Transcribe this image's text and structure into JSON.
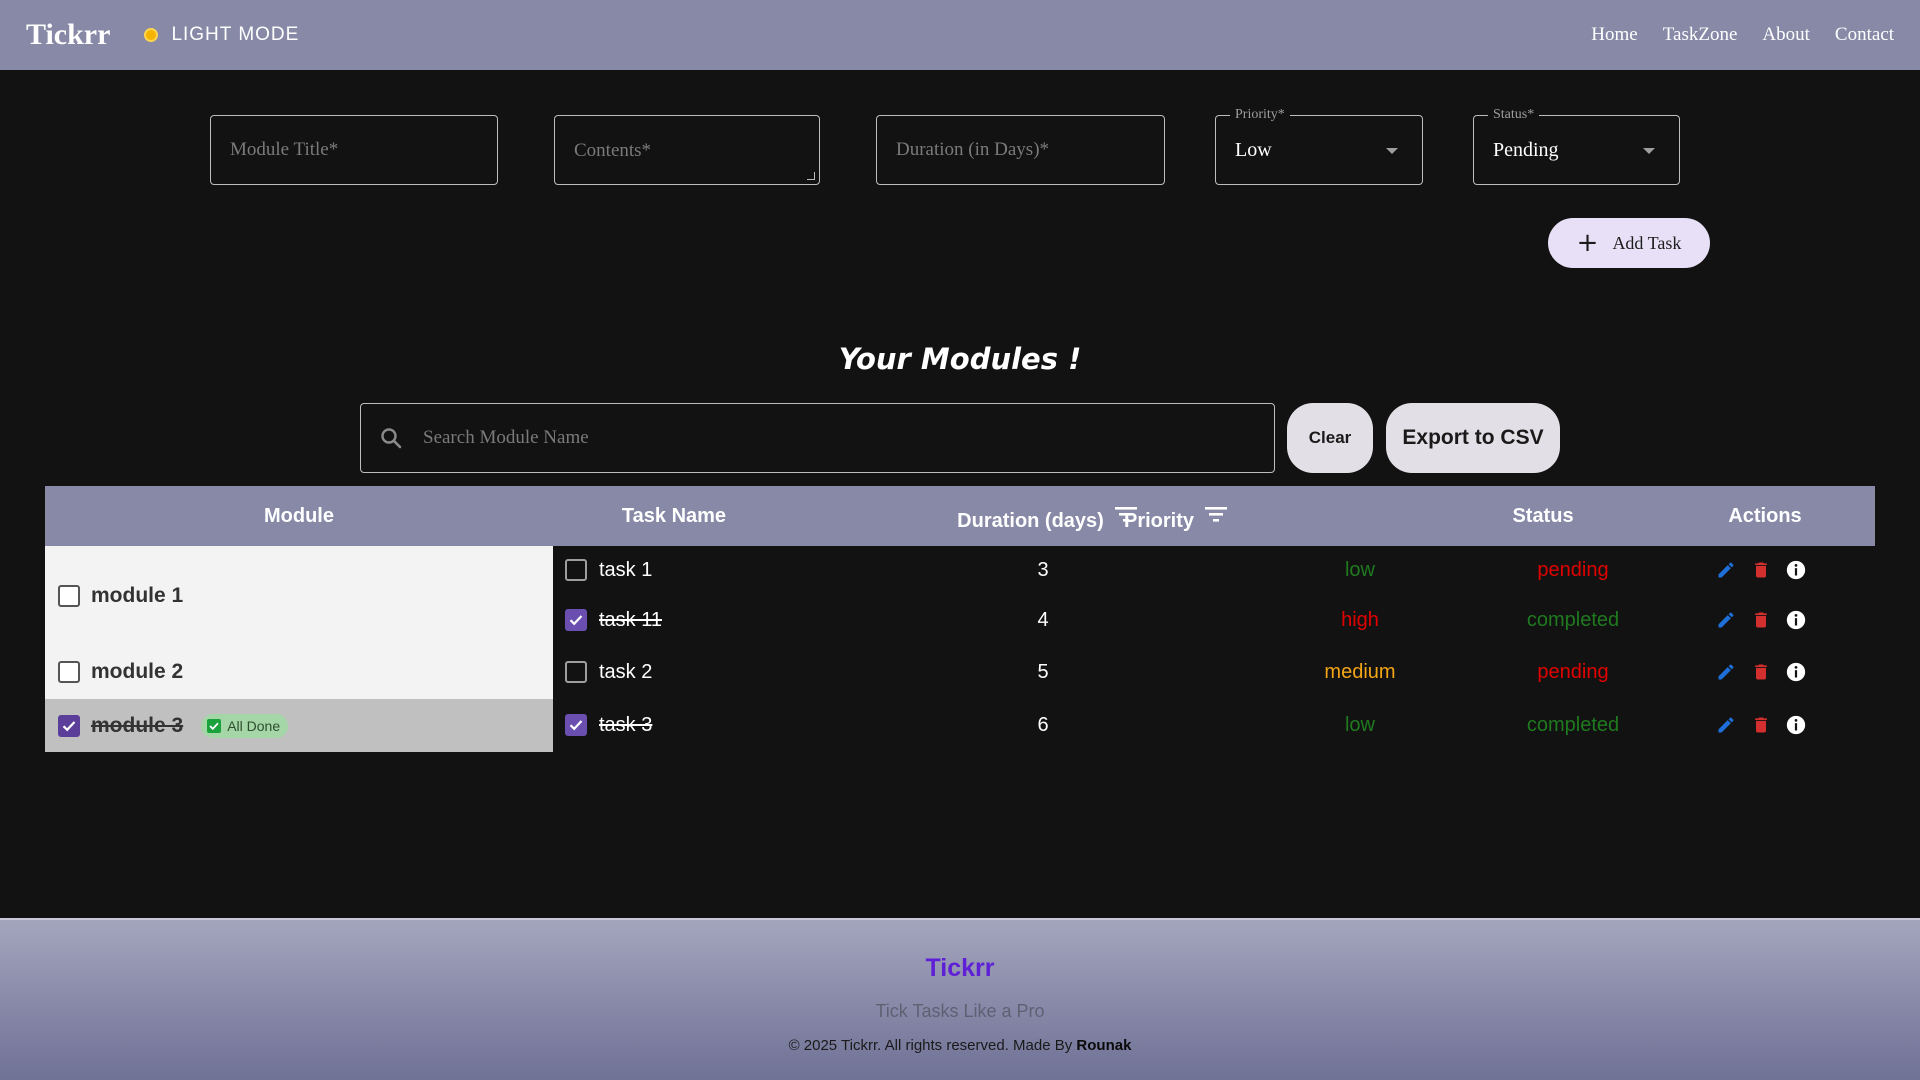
{
  "navbar": {
    "brand": "Tickrr",
    "mode_label": "LIGHT MODE",
    "links": [
      "Home",
      "TaskZone",
      "About",
      "Contact"
    ]
  },
  "form": {
    "module_title_placeholder": "Module Title*",
    "contents_placeholder": "Contents*",
    "duration_placeholder": "Duration (in Days)*",
    "priority_label": "Priority*",
    "priority_value": "Low",
    "status_label": "Status*",
    "status_value": "Pending",
    "add_button": "Add Task"
  },
  "modules_section": {
    "title": "Your Modules !",
    "search_placeholder": "Search Module Name",
    "clear_button": "Clear",
    "export_button": "Export to CSV"
  },
  "table": {
    "headers": [
      "Module",
      "Task Name",
      "Duration (days)",
      "Priority",
      "Status",
      "Actions"
    ],
    "modules": [
      {
        "name": "module 1",
        "checked": false
      },
      {
        "name": "module 2",
        "checked": false
      },
      {
        "name": "module 3",
        "checked": true,
        "badge": "All Done"
      }
    ],
    "tasks": [
      {
        "name": "task 1",
        "checked": false,
        "duration": "3",
        "priority": "low",
        "status": "pending"
      },
      {
        "name": "task 11",
        "checked": true,
        "duration": "4",
        "priority": "high",
        "status": "completed"
      },
      {
        "name": "task 2",
        "checked": false,
        "duration": "5",
        "priority": "medium",
        "status": "pending"
      },
      {
        "name": "task 3",
        "checked": true,
        "duration": "6",
        "priority": "low",
        "status": "completed"
      }
    ]
  },
  "colors": {
    "navbar_bg": "#8789a7",
    "priority_low": "#1f7a1f",
    "priority_high": "#e00000",
    "priority_medium": "#f2a515",
    "status_pending": "#e00000",
    "status_completed": "#1f7a1f",
    "edit_icon": "#1e6fd9",
    "delete_icon": "#d32f2f",
    "footer_brand": "#5e1fd6"
  },
  "icons": {
    "mode": "sun-dot-icon",
    "search": "search-icon",
    "add": "plus-icon",
    "sort": "filter-list-icon",
    "edit": "pencil-icon",
    "delete": "trash-icon",
    "info": "info-icon"
  },
  "footer": {
    "brand": "Tickrr",
    "tagline": "Tick Tasks Like a Pro",
    "copyright": "© 2025 Tickrr. All rights reserved. Made By",
    "author": "Rounak"
  }
}
